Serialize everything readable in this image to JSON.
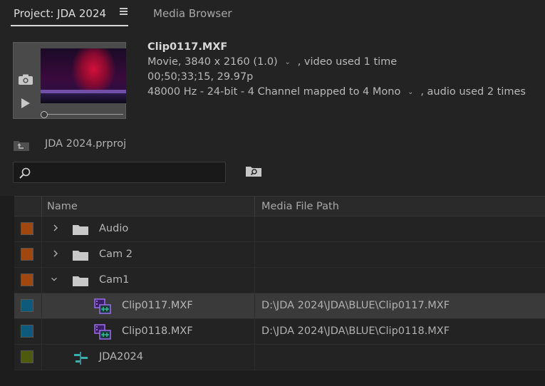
{
  "tabs": {
    "project_label": "Project: JDA 2024",
    "media_browser_label": "Media Browser"
  },
  "clip_info": {
    "name": "Clip0117.MXF",
    "video_desc": "Movie, 3840 x 2160 (1.0)",
    "video_usage": ", video used 1 time",
    "timecode_fps": "00;50;33;15, 29.97p",
    "audio_desc": "48000 Hz - 24-bit - 4 Channel mapped to 4 Mono",
    "audio_usage": ", audio used 2 times"
  },
  "project": {
    "file_name": "JDA 2024.prproj"
  },
  "search": {
    "value": "",
    "placeholder": ""
  },
  "columns": {
    "name": "Name",
    "path": "Media File Path"
  },
  "rows": [
    {
      "name": "Audio",
      "type": "bin",
      "label_color": "#a0460f",
      "expanded": false,
      "path": ""
    },
    {
      "name": "Cam 2",
      "type": "bin",
      "label_color": "#a0460f",
      "expanded": false,
      "path": ""
    },
    {
      "name": "Cam1",
      "type": "bin",
      "label_color": "#a0460f",
      "expanded": true,
      "path": ""
    },
    {
      "name": "Clip0117.MXF",
      "type": "clip",
      "label_color": "#0e5a7a",
      "selected": true,
      "path": "D:\\JDA 2024\\JDA\\BLUE\\Clip0117.MXF"
    },
    {
      "name": "Clip0118.MXF",
      "type": "clip",
      "label_color": "#0e5a7a",
      "selected": false,
      "path": "D:\\JDA 2024\\JDA\\BLUE\\Clip0118.MXF"
    },
    {
      "name": "JDA2024",
      "type": "sequence",
      "label_color": "#4e5a0e",
      "path": ""
    }
  ],
  "colors": {
    "accent_clip_icon": "#9b6cf0",
    "sequence_icon": "#3ab0b0"
  }
}
